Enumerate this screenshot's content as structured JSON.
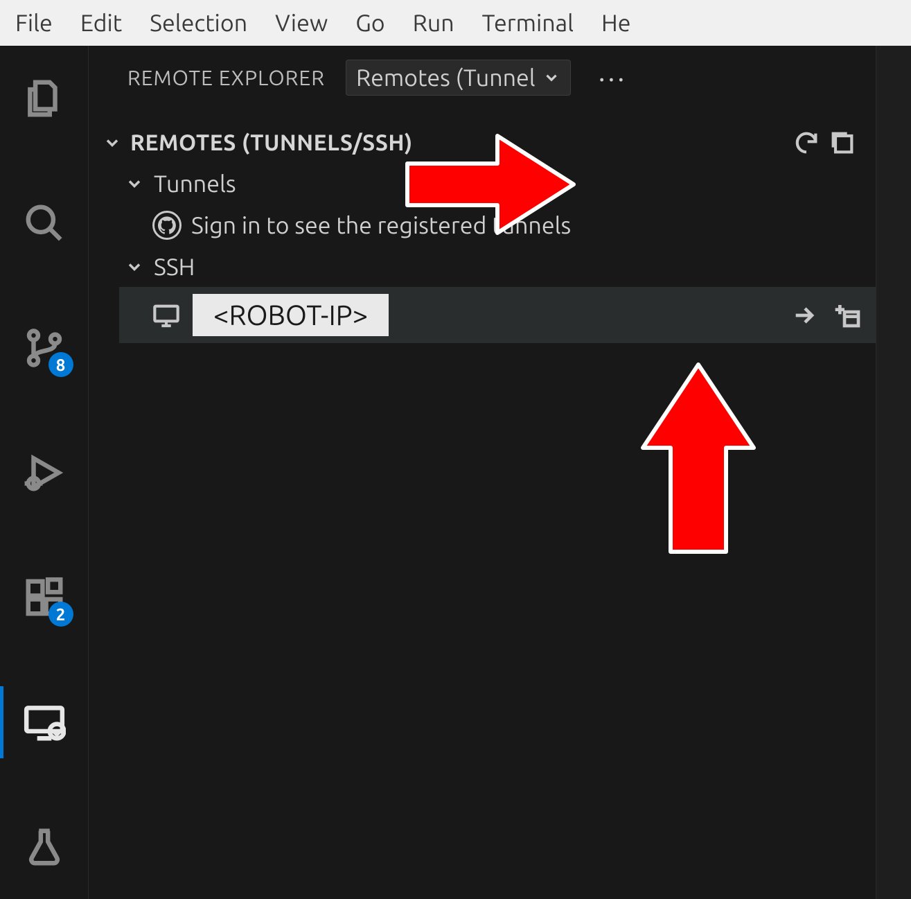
{
  "menubar": {
    "items": [
      "File",
      "Edit",
      "Selection",
      "View",
      "Go",
      "Run",
      "Terminal",
      "He"
    ]
  },
  "activitybar": {
    "scm_badge": "8",
    "extensions_badge": "2"
  },
  "sidebar": {
    "title": "REMOTE EXPLORER",
    "dropdown_label": "Remotes (Tunnel",
    "more_label": "···",
    "section_title": "REMOTES (TUNNELS/SSH)",
    "tunnels_label": "Tunnels",
    "tunnels_signin": "Sign in to see the registered tunnels",
    "ssh_label": "SSH",
    "ssh_host": "<ROBOT-IP>"
  }
}
